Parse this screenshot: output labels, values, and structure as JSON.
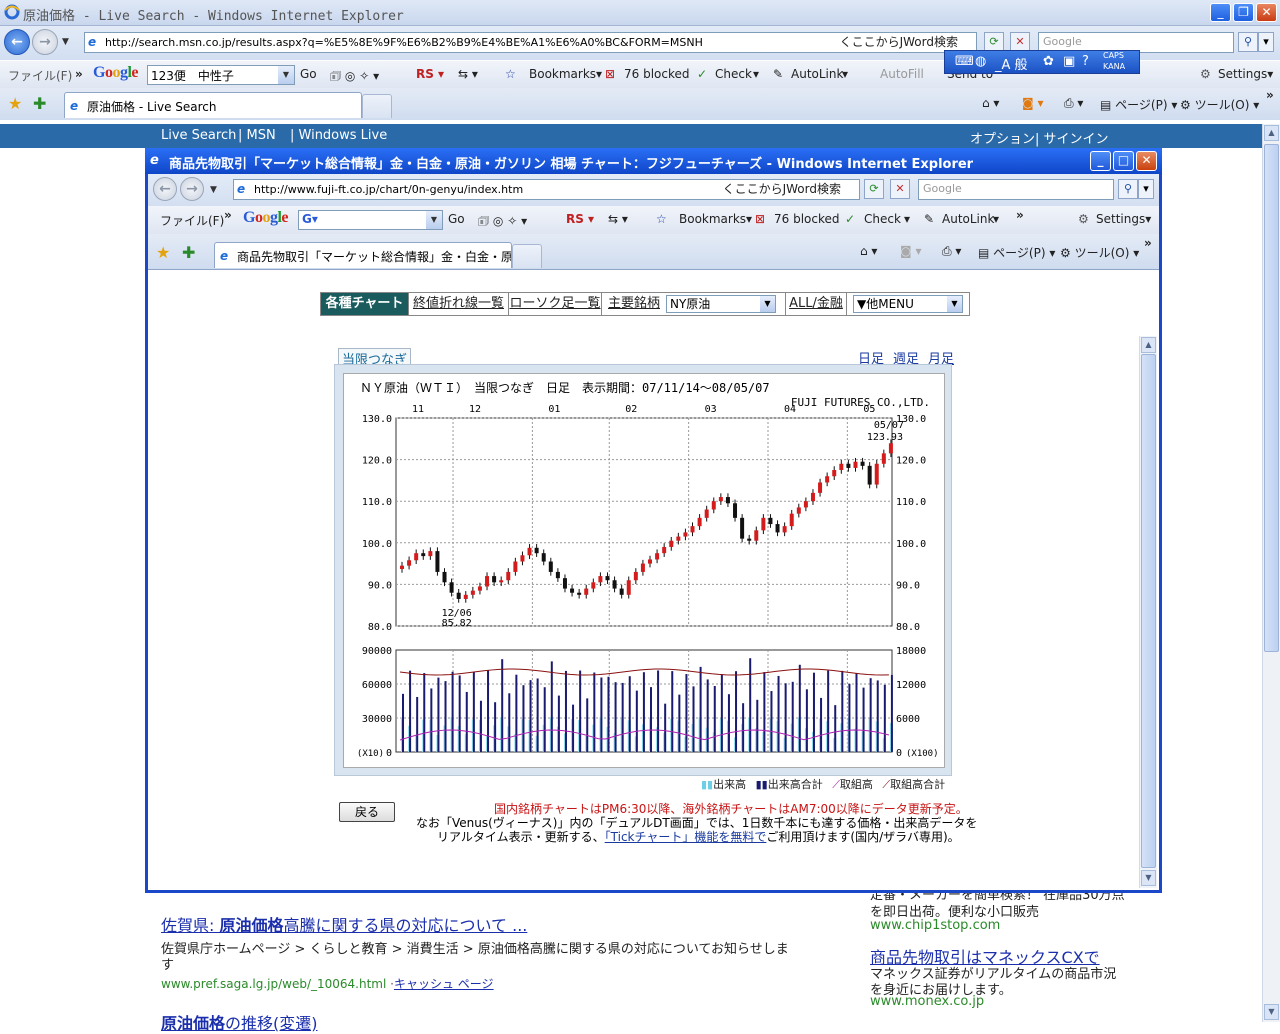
{
  "outer": {
    "window_title": "原油価格 - Live Search - Windows Internet Explorer",
    "url": "http://search.msn.co.jp/results.aspx?q=%E5%8E%9F%E6%B2%B9%E4%BE%A1%E6%A0%BC&FORM=MSNH",
    "jword": "くここからJWord検索",
    "search_placeholder": "Google",
    "menu_file": "ファイル(F)",
    "google_combo": "123便　中性子",
    "go": "Go",
    "bookmarks": "Bookmarks▾",
    "blocked": "76 blocked",
    "check": "Check",
    "autolink": "AutoLink",
    "autofill": "AutoFill",
    "send_to": "Send to",
    "settings": "Settings▾",
    "ime_mode": "_A 般",
    "caps": "CAPS",
    "kana": "KANA",
    "tab_title": "原油価格 - Live Search",
    "page_menu": "ページ(P)",
    "tools_menu": "ツール(O)"
  },
  "live_nav": {
    "live_search": "Live Search",
    "msn": "|  MSN",
    "windows_live": "|  Windows Live",
    "options": "オプション",
    "signin": "|  サインイン"
  },
  "results": {
    "r1_title_prefix": "佐賀県: ",
    "r1_title_bold": "原油価格",
    "r1_title_rest": "高騰に関する県の対応について ...",
    "r1_desc1": "佐賀県庁ホームページ > くらしと教育 > 消費生活 > 原油価格高騰に関する県の対応についてお知らせしま",
    "r1_desc2": "す",
    "r1_url": "www.pref.saga.lg.jp/web/_10064.html",
    "r1_cache": "キャッシュ ページ",
    "r2_partial_bold": "原油価格",
    "r2_partial_rest": "の推移(変遷)",
    "ad1_line1": "定番・メーカーを簡単検索！ 在庫品30万点",
    "ad1_line2": "を即日出荷。便利な小口販売",
    "ad1_url": "www.chip1stop.com",
    "ad2_title": "商品先物取引はマネックスCXで",
    "ad2_line1": "マネックス証券がリアルタイムの商品市況",
    "ad2_line2": "を身近にお届けします。",
    "ad2_url": "www.monex.co.jp"
  },
  "popup": {
    "title": "商品先物取引「マーケット総合情報」金・白金・原油・ガソリン 相場 チャート：フジフューチャーズ - Windows Internet Explorer",
    "url": "http://www.fuji-ft.co.jp/chart/0n-genyu/index.htm",
    "jword": "くここからJWord検索",
    "search_placeholder": "Google",
    "menu_file": "ファイル(F)",
    "go": "Go",
    "bookmarks": "Bookmarks▾",
    "blocked": "76 blocked",
    "check": "Check",
    "autolink": "AutoLink",
    "settings": "Settings▾",
    "tab_title": "商品先物取引「マーケット総合情報」金・白金・原油・ガ...",
    "page_menu": "ページ(P)",
    "tools_menu": "ツール(O)"
  },
  "site_menu": {
    "charts": "各種チャート",
    "closing_list": "終値折れ線一覧",
    "candle_list": "ローソク足一覧",
    "major": "主要銘柄",
    "selected_commodity": "NY原油",
    "all_finance": "ALL/金融",
    "other_menu": "▼他MENU"
  },
  "chart_view": {
    "tag": "当限つなぎ",
    "daily": "日足",
    "weekly": "週足",
    "monthly": "月足",
    "back": "戻る",
    "legend_volume": "出来高",
    "legend_volume_total": "出来高合計",
    "legend_oi": "取組高",
    "legend_oi_total": "取組高合計",
    "notice_red": "国内銘柄チャートはPM6:30以降、海外銘柄チャートはAM7:00以降にデータ更新予定。",
    "notice_2": "なお「Venus(ヴィーナス)」内の「デュアルDT画面」では、1日数千本にも達する価格・出来高データを",
    "notice_3_pre": "リアルタイム表示・更新する、",
    "notice_3_link": "「Tickチャート」機能を無料で",
    "notice_3_post": "ご利用頂けます(国内/ザラバ専用)。"
  },
  "chart_data": {
    "type": "candlestick",
    "title": "ＮＹ原油（ＷＴＩ）　当限つなぎ　日足　表示期間：07/11/14～08/05/07",
    "source": "FUJI FUTURES CO.,LTD.",
    "month_labels": [
      "11",
      "12",
      "01",
      "02",
      "03",
      "04",
      "05"
    ],
    "price_axis": {
      "ticks": [
        "130.0",
        "120.0",
        "110.0",
        "100.0",
        "90.0",
        "80.0"
      ],
      "ylim": [
        80,
        130
      ]
    },
    "volume_axis_left": {
      "ticks": [
        "90000",
        "60000",
        "30000",
        "0"
      ],
      "unit": "(X10)"
    },
    "volume_axis_right": {
      "ticks": [
        "18000",
        "12000",
        "6000",
        "0"
      ],
      "unit": "(X100)"
    },
    "annotations": [
      {
        "date": "12/06",
        "value": "85.82",
        "kind": "low"
      },
      {
        "date": "05/07",
        "value": "123.93",
        "kind": "last"
      }
    ],
    "close_series": [
      94.5,
      95.8,
      97.5,
      96.8,
      98.0,
      93.0,
      90.5,
      88.0,
      86.5,
      87.5,
      88.5,
      89.5,
      92.0,
      90.5,
      91.0,
      93.0,
      95.5,
      97.0,
      98.8,
      97.5,
      95.5,
      93.0,
      91.5,
      89.0,
      88.0,
      87.5,
      89.0,
      90.5,
      92.0,
      91.0,
      89.0,
      87.5,
      91.0,
      93.0,
      95.0,
      96.0,
      97.5,
      99.0,
      100.5,
      101.5,
      102.5,
      104.0,
      106.0,
      108.0,
      110.0,
      111.0,
      109.5,
      106.0,
      101.0,
      100.5,
      103.0,
      106.0,
      104.5,
      102.5,
      104.0,
      107.0,
      108.5,
      110.0,
      112.0,
      114.5,
      116.0,
      117.5,
      119.0,
      118.0,
      119.5,
      118.5,
      114.0,
      119.0,
      121.5,
      123.93
    ]
  }
}
